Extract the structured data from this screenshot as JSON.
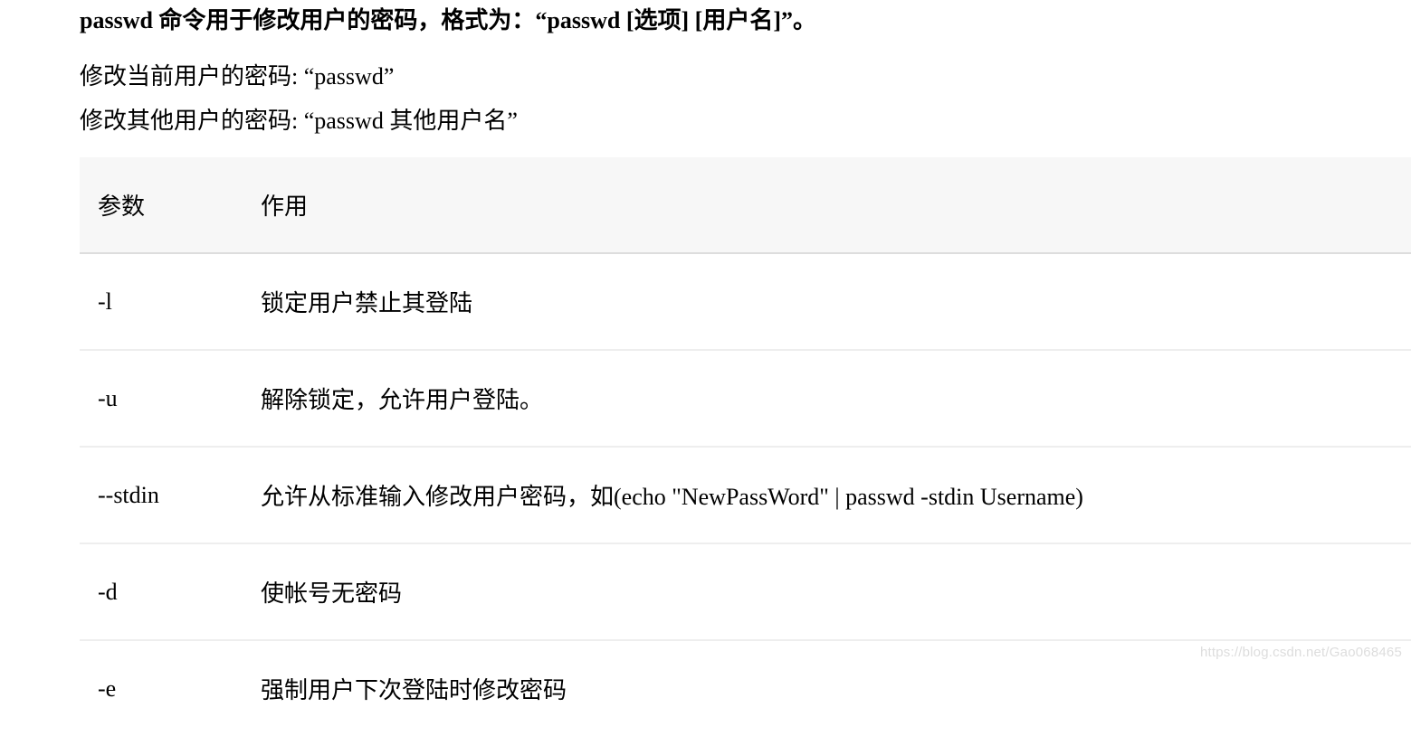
{
  "heading": "passwd 命令用于修改用户的密码，格式为：“passwd [选项] [用户名]”。",
  "line1": "修改当前用户的密码: “passwd”",
  "line2": "修改其他用户的密码: “passwd  其他用户名”",
  "table": {
    "headers": {
      "param": "参数",
      "desc": "作用"
    },
    "rows": [
      {
        "param": "-l",
        "desc": "锁定用户禁止其登陆"
      },
      {
        "param": "-u",
        "desc": "解除锁定，允许用户登陆。"
      },
      {
        "param": "--stdin",
        "desc": "允许从标准输入修改用户密码，如(echo \"NewPassWord\" | passwd -stdin Username)"
      },
      {
        "param": "-d",
        "desc": "使帐号无密码"
      },
      {
        "param": "-e",
        "desc": "强制用户下次登陆时修改密码"
      }
    ]
  },
  "watermark": "https://blog.csdn.net/Gao068465"
}
